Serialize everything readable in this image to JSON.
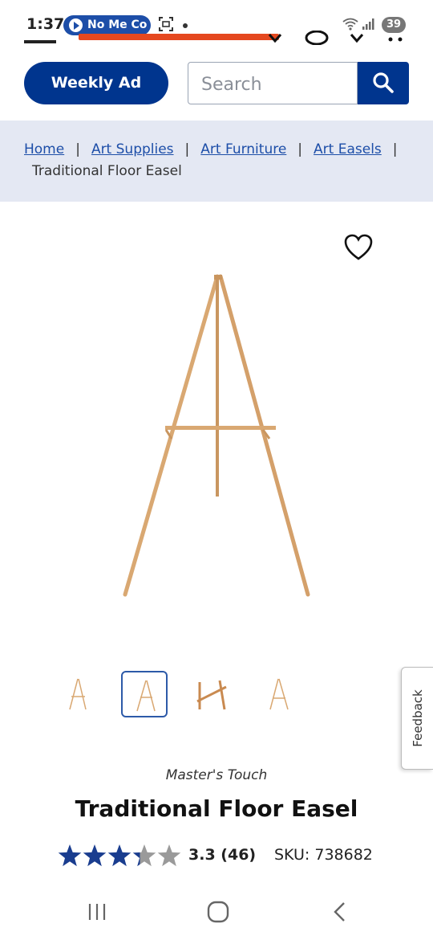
{
  "status_bar": {
    "time": "1:37",
    "notification_label": "No Me Co",
    "battery": "39"
  },
  "header": {
    "weekly_ad_label": "Weekly Ad",
    "search_placeholder": "Search"
  },
  "breadcrumb": {
    "links": [
      "Home",
      "Art Supplies",
      "Art Furniture",
      "Art Easels"
    ],
    "separator": "|",
    "current": "Traditional Floor Easel"
  },
  "gallery": {
    "thumbnail_count": 4,
    "selected_index": 1
  },
  "feedback_label": "Feedback",
  "product": {
    "brand": "Master's Touch",
    "title": "Traditional Floor Easel",
    "rating_value": 3.3,
    "rating_text": "3.3",
    "review_count": "(46)",
    "sku_text": "SKU: 738682",
    "max_stars": 5
  },
  "colors": {
    "brand_blue": "#00358e",
    "link_blue": "#1d4ea8",
    "breadcrumb_bg": "#e4e8f3",
    "star_filled": "#1a3d8f",
    "star_empty": "#9a9a9a",
    "wood": "#d9a872"
  },
  "icons": {
    "menu": "hamburger-icon",
    "search": "magnifier-icon",
    "wishlist": "heart-outline-icon",
    "nav_recents": "recents-icon",
    "nav_home": "home-icon",
    "nav_back": "back-icon"
  }
}
